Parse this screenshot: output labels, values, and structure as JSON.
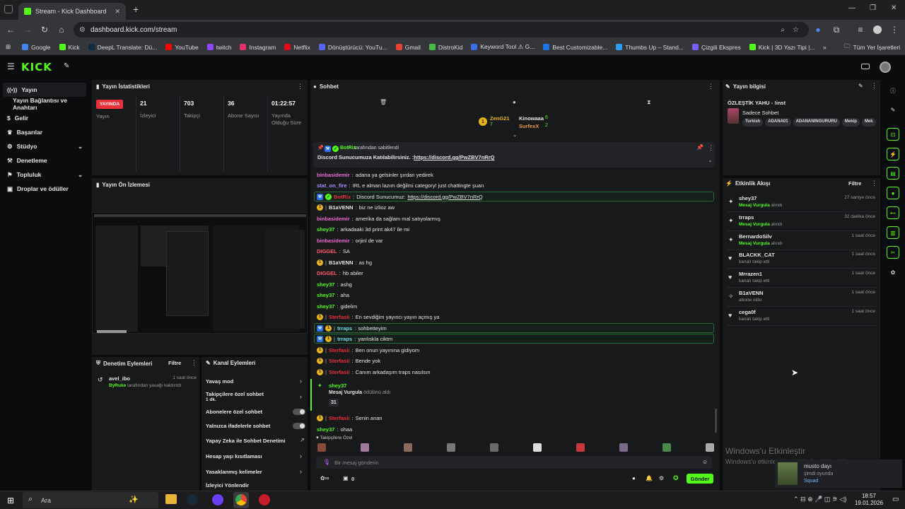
{
  "browser": {
    "tab_title": "Stream - Kick Dashboard",
    "url": "dashboard.kick.com/stream",
    "bookmarks": [
      "Google",
      "Kick",
      "DeepL Translate: Dü...",
      "YouTube",
      "twitch",
      "Instagram",
      "Netflix",
      "Dönüştürücü: YouTu...",
      "Gmail",
      "DistroKid",
      "Keyword Tool ⚠ G...",
      "Best Customizable...",
      "Thumbs Up – Stand...",
      "Çizgili Ekspres",
      "Kick | 3D Yazı Tipi |..."
    ],
    "all_bookmarks": "Tüm Yer İşaretleri",
    "bookmark_colors": [
      "#4285f4",
      "#53fc18",
      "#0f2b46",
      "#ff0000",
      "#9146ff",
      "#e1306c",
      "#e50914",
      "#5865f2",
      "#ea4335",
      "#44bb44",
      "#3a6ee8",
      "#1b73e8",
      "#2a9df4",
      "#7a5cff",
      "#53fc18"
    ]
  },
  "app": {
    "logo": "KICK"
  },
  "sidebar": {
    "items": [
      {
        "label": "Yayın",
        "icon": "broadcast-icon"
      },
      {
        "label": "Yayın Bağlantısı ve Anahtarı",
        "icon": ""
      },
      {
        "label": "Gelir",
        "icon": "money-icon"
      },
      {
        "label": "Başarılar",
        "icon": "trophy-icon"
      },
      {
        "label": "Stüdyo",
        "icon": "studio-icon"
      },
      {
        "label": "Denetleme",
        "icon": "hammer-icon"
      },
      {
        "label": "Topluluk",
        "icon": "community-icon"
      },
      {
        "label": "Droplar ve ödüller",
        "icon": "gift-icon"
      }
    ]
  },
  "stats": {
    "title": "Yayın İstatistikleri",
    "live_badge": "YAYINDA",
    "status_label": "Yayın",
    "viewers_value": "21",
    "viewers_label": "İzleyici",
    "followers_value": "703",
    "followers_label": "Takipçi",
    "subs_value": "36",
    "subs_label": "Abone Sayısı",
    "uptime_value": "01:22:57",
    "uptime_label": "Yayında Olduğu Süre"
  },
  "preview": {
    "title": "Yayın Ön İzlemesi"
  },
  "mod_actions": {
    "title": "Denetim Eylemleri",
    "filter": "Filtre",
    "item_user": "avel_ibo",
    "item_time": "1 saat önce",
    "item_actor": "ByRuke",
    "item_text": "tarafından yasağı kaldırıldı"
  },
  "channel_actions": {
    "title": "Kanal Eylemleri",
    "items": [
      "Yavaş mod",
      "Takipçilere özel sohbet",
      "Abonelere özel sohbet",
      "Yalnızca ifadelerle sohbet",
      "Yapay Zeka ile Sohbet Denetimi",
      "Hesap yaşı kısıtlaması",
      "Yasaklanmış kelimeler",
      "İzleyici Yönlendir"
    ],
    "followers_sub": "1 dk."
  },
  "chat": {
    "title": "Sohbet",
    "top_gifters": [
      {
        "name": "ZenG21",
        "count": "7"
      },
      {
        "name": "Kinowaaa",
        "count": "6"
      },
      {
        "name": "SurfexX",
        "count": "2"
      }
    ],
    "pinned_by": "BotRix",
    "pinned_by_text": "tarafından sabitlendi",
    "pinned_prefix": "Discord Sunucumuza Katılabilirsiniz. :",
    "pinned_link": "https://discord.gg/PwZBV7nRrQ",
    "messages": [
      {
        "user": "binbasidemir",
        "text": "adana ya gelsinler şırdan yedirek",
        "color": "#e86ad0"
      },
      {
        "user": "stat_on_fire",
        "text": "IRL e alman lazım değilmi category! just chattingte şuan",
        "color": "#a98cff"
      },
      {
        "user": "BotRix",
        "text": "Discord Sunucumuz: ",
        "link": "https://discord.gg/PwZBV7nRrQ",
        "color": "#e8303a"
      },
      {
        "user": "B1aVENN",
        "text": "biz ne izlioz aw",
        "color": "#e6e6e6"
      },
      {
        "user": "binbasidemir",
        "text": "amerika da sağlam mal satıyolarmış",
        "color": "#e86ad0"
      },
      {
        "user": "shey37",
        "text": "arkadaaki 3d print ak47 ile mi",
        "color": "#53fc18"
      },
      {
        "user": "binbasidemir",
        "text": "orjinl de var",
        "color": "#e86ad0"
      },
      {
        "user": "DIGGEL",
        "text": "SA",
        "color": "#ff5a6a"
      },
      {
        "user": "B1aVENN",
        "text": "as hg",
        "color": "#e6e6e6"
      },
      {
        "user": "DIGGEL",
        "text": "hb abiler",
        "color": "#ff5a6a"
      },
      {
        "user": "shey37",
        "text": "ashg",
        "color": "#53fc18"
      },
      {
        "user": "shey37",
        "text": "aha",
        "color": "#53fc18"
      },
      {
        "user": "shey37",
        "text": "gidelim",
        "color": "#53fc18"
      },
      {
        "user": "Sterfasii",
        "text": "En sevdiğim yayıncı yayın açmış ya",
        "color": "#e8303a"
      },
      {
        "user": "trraps",
        "text": "sohbetteyim",
        "color": "#6ad8e8"
      },
      {
        "user": "trraps",
        "text": "yanlıskla ciktm",
        "color": "#6ad8e8"
      },
      {
        "user": "Sterfasii",
        "text": "Ben onun yayınına gidiyom",
        "color": "#e8303a"
      },
      {
        "user": "Sterfasii",
        "text": "Bende yok",
        "color": "#e8303a"
      },
      {
        "user": "Sterfasii",
        "text": "Canım arkadaşım traps nasılsın",
        "color": "#e8303a"
      }
    ],
    "reward_user": "shey37",
    "reward_title": "Mesaj Vurgula",
    "reward_text": "ödülünü aldı",
    "reward_value": "31",
    "messages2": [
      {
        "user": "Sterfasii",
        "text": "Senin anan",
        "color": "#e8303a"
      },
      {
        "user": "shey37",
        "text": "ohaa",
        "color": "#53fc18"
      }
    ],
    "followers_only": "Takipçilere Özel",
    "input_placeholder": "Bir mesaj gönderin",
    "points": "0",
    "send": "Gönder"
  },
  "stream_info": {
    "title": "Yayın bilgisi",
    "stream_title": "ÖZLEŞTİK YAHU - !inst",
    "category": "Sadece Sohbet",
    "tags": [
      "Turkish",
      "ADANA01",
      "ADANANINGURURU",
      "Mekip",
      "Mek"
    ]
  },
  "activity": {
    "title": "Etkinlik Akışı",
    "filter": "Filtre",
    "items": [
      {
        "user": "shey37",
        "desc_hl": "Mesaj Vurgula",
        "desc": "alındı",
        "time": "27 saniye önce",
        "icon": "star-icon"
      },
      {
        "user": "trraps",
        "desc_hl": "Mesaj Vurgula",
        "desc": "alındı",
        "time": "32 dakika önce",
        "icon": "star-icon"
      },
      {
        "user": "BernardoSilv",
        "desc_hl": "Mesaj Vurgula",
        "desc": "alındı",
        "time": "1 saat önce",
        "icon": "star-icon"
      },
      {
        "user": "BLACKK_CAT",
        "desc_hl": "",
        "desc": "kanalı takip etti",
        "time": "1 saat önce",
        "icon": "heart-icon"
      },
      {
        "user": "Mrrazen1",
        "desc_hl": "",
        "desc": "kanalı takip etti",
        "time": "1 saat önce",
        "icon": "heart-icon"
      },
      {
        "user": "B1aVENN",
        "desc_hl": "",
        "desc": "abone oldu",
        "time": "1 saat önce",
        "icon": "sparkle-icon"
      },
      {
        "user": "cega0f",
        "desc_hl": "",
        "desc": "kanalı takip etti",
        "time": "1 saat önce",
        "icon": "heart-icon"
      }
    ]
  },
  "windows": {
    "activate_title": "Windows'u Etkinleştir",
    "activate_sub": "Windows'u etkinleştirmek için Ayarlar'a gidin.",
    "search": "Ara",
    "time": "18:57",
    "date": "19.01.2026"
  },
  "notification": {
    "name": "musto dayı",
    "status": "şimdi oyunda",
    "game": "Squad"
  }
}
